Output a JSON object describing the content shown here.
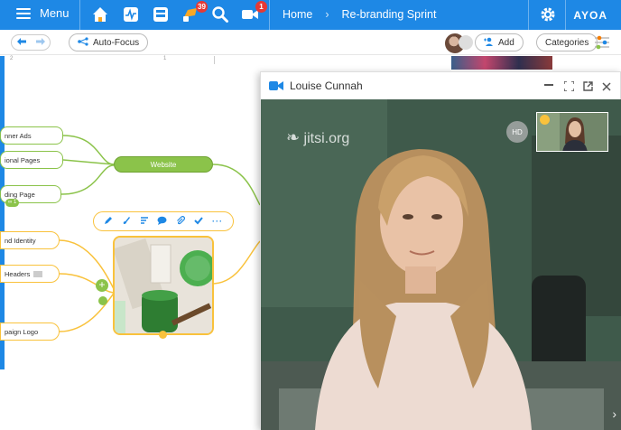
{
  "topbar": {
    "menu_label": "Menu",
    "notification_count": "39",
    "video_badge": "1",
    "breadcrumb_home": "Home",
    "breadcrumb_current": "Re-branding Sprint",
    "logo": "AYOA"
  },
  "toolbar": {
    "auto_focus_label": "Auto-Focus",
    "add_label": "Add",
    "categories_label": "Categories"
  },
  "ruler": {
    "mark_a": "2",
    "mark_b": "1"
  },
  "mindmap": {
    "green_nodes": [
      "nner Ads",
      "ional Pages",
      "ding Page"
    ],
    "central_node": "Website",
    "orange_nodes": [
      "nd Identity",
      "Headers",
      "paign Logo"
    ],
    "landing_page_badge": "1"
  },
  "video": {
    "caller_name": "Louise Cunnah",
    "watermark": "jitsi.org",
    "quality_badge": "HD",
    "accent": "#1e88e5"
  },
  "colors": {
    "brand_blue": "#1e88e5",
    "branch_green": "#8bc34a",
    "branch_orange": "#f9c23c"
  }
}
